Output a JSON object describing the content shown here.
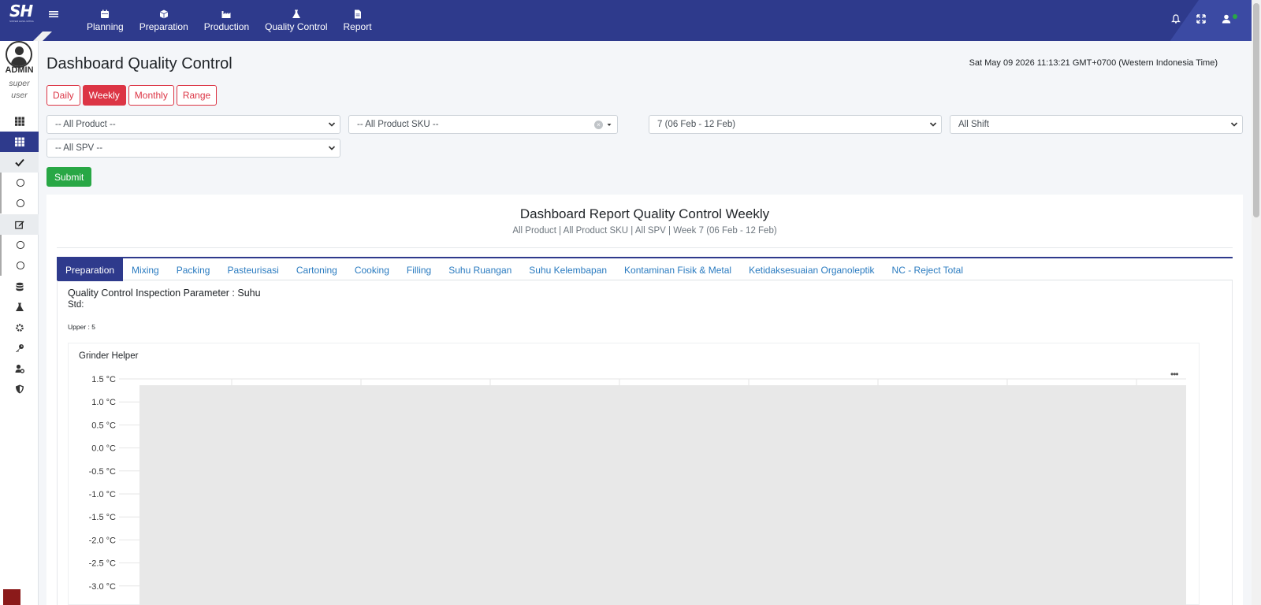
{
  "logo": {
    "text": "SH",
    "sub": "SISTEM HASIL MITRA"
  },
  "nav": [
    {
      "label": "Planning",
      "icon": "calendar-icon"
    },
    {
      "label": "Preparation",
      "icon": "cube-icon"
    },
    {
      "label": "Production",
      "icon": "factory-icon"
    },
    {
      "label": "Quality Control",
      "icon": "flask-icon"
    },
    {
      "label": "Report",
      "icon": "file-icon"
    }
  ],
  "user": {
    "name": "ADMIN",
    "role_line1": "super",
    "role_line2": "user"
  },
  "page": {
    "title": "Dashboard Quality Control",
    "datetime": "Sat May 09 2026 11:13:21 GMT+0700 (Western Indonesia Time)"
  },
  "periods": [
    "Daily",
    "Weekly",
    "Monthly",
    "Range"
  ],
  "active_period": "Weekly",
  "filters": {
    "product": "-- All Product --",
    "sku": "-- All Product SKU --",
    "week": "7 (06 Feb - 12 Feb)",
    "shift": "All Shift",
    "spv": "-- All SPV --"
  },
  "submit_label": "Submit",
  "report": {
    "title": "Dashboard Report Quality Control Weekly",
    "subtitle": "All Product | All Product SKU | All SPV | Week 7 (06 Feb - 12 Feb)"
  },
  "tabs": [
    "Preparation",
    "Mixing",
    "Packing",
    "Pasteurisasi",
    "Cartoning",
    "Cooking",
    "Filling",
    "Suhu Ruangan",
    "Suhu Kelembapan",
    "Kontaminan Fisik & Metal",
    "Ketidaksesuaian Organoleptik",
    "NC - Reject Total"
  ],
  "active_tab": "Preparation",
  "parameter": {
    "title": "Quality Control Inspection Parameter : Suhu",
    "std": "Std:",
    "upper": "Upper : 5"
  },
  "chart_data": {
    "type": "line",
    "title": "Grinder Helper",
    "y_ticks": [
      "1.5 °C",
      "1.0 °C",
      "0.5 °C",
      "0.0 °C",
      "-0.5 °C",
      "-1.0 °C",
      "-1.5 °C",
      "-2.0 °C",
      "-2.5 °C",
      "-3.0 °C"
    ],
    "ylim": [
      -3.0,
      1.5
    ],
    "series": [],
    "shaded_band": true,
    "grid": true
  },
  "colors": {
    "primary": "#2e3a8c",
    "danger": "#dc3545",
    "success": "#28a745",
    "link": "#2a7bc0"
  }
}
